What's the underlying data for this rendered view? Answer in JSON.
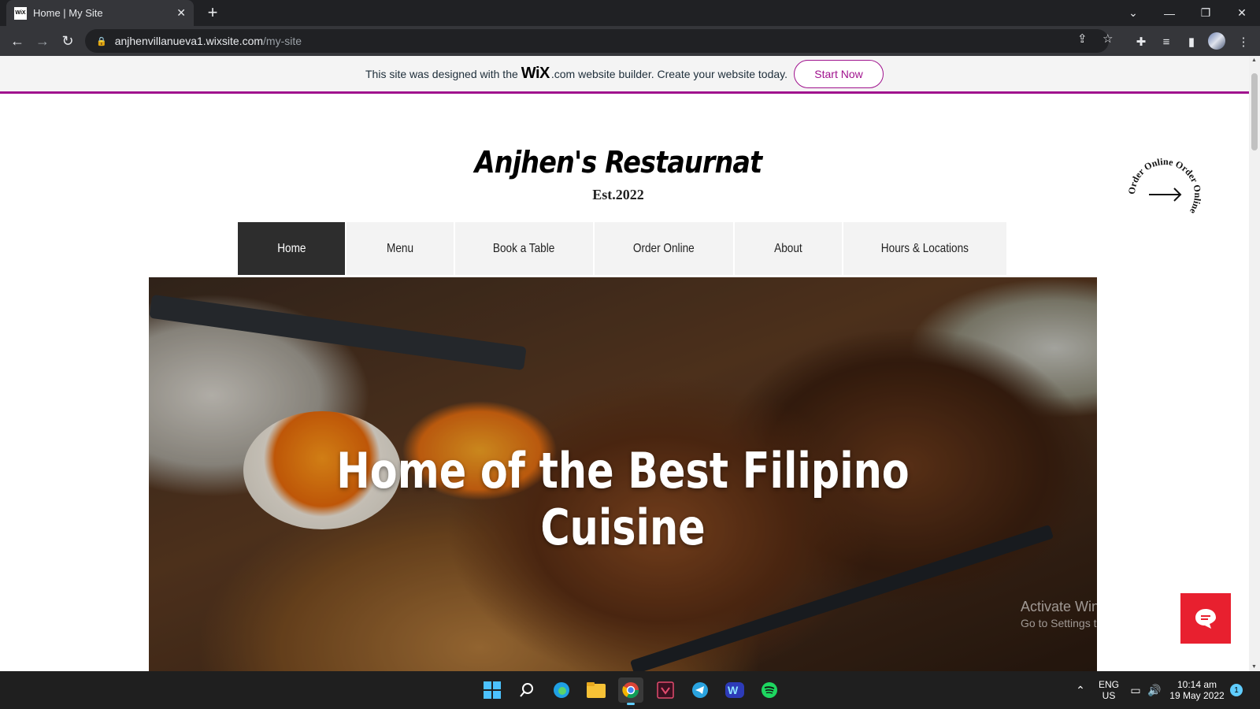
{
  "browser": {
    "tab_title": "Home | My Site",
    "tab_favicon": "WiX",
    "url_host": "anjhenvillanueva1.wixsite.com",
    "url_path": "/my-site"
  },
  "wix_banner": {
    "text_before": "This site was designed with the",
    "logo": "WiX",
    "text_after": ".com website builder. Create your website today.",
    "button": "Start Now",
    "accent": "#a0138e"
  },
  "site": {
    "title": "Anjhen's Restaurnat",
    "subtitle": "Est.2022",
    "nav": [
      {
        "label": "Home",
        "active": true
      },
      {
        "label": "Menu"
      },
      {
        "label": "Book a Table"
      },
      {
        "label": "Order Online"
      },
      {
        "label": "About"
      },
      {
        "label": "Hours & Locations"
      }
    ],
    "order_badge_text": "Order Online Order Online ",
    "hero_line1": "Home of the Best Filipino",
    "hero_line2": "Cuisine"
  },
  "overlay": {
    "activate_title": "Activate Windows",
    "activate_sub": "Go to Settings to activate Windows."
  },
  "taskbar": {
    "lang": "ENG",
    "region": "US",
    "time": "10:14 am",
    "date": "19 May 2022",
    "notifications": "1"
  }
}
